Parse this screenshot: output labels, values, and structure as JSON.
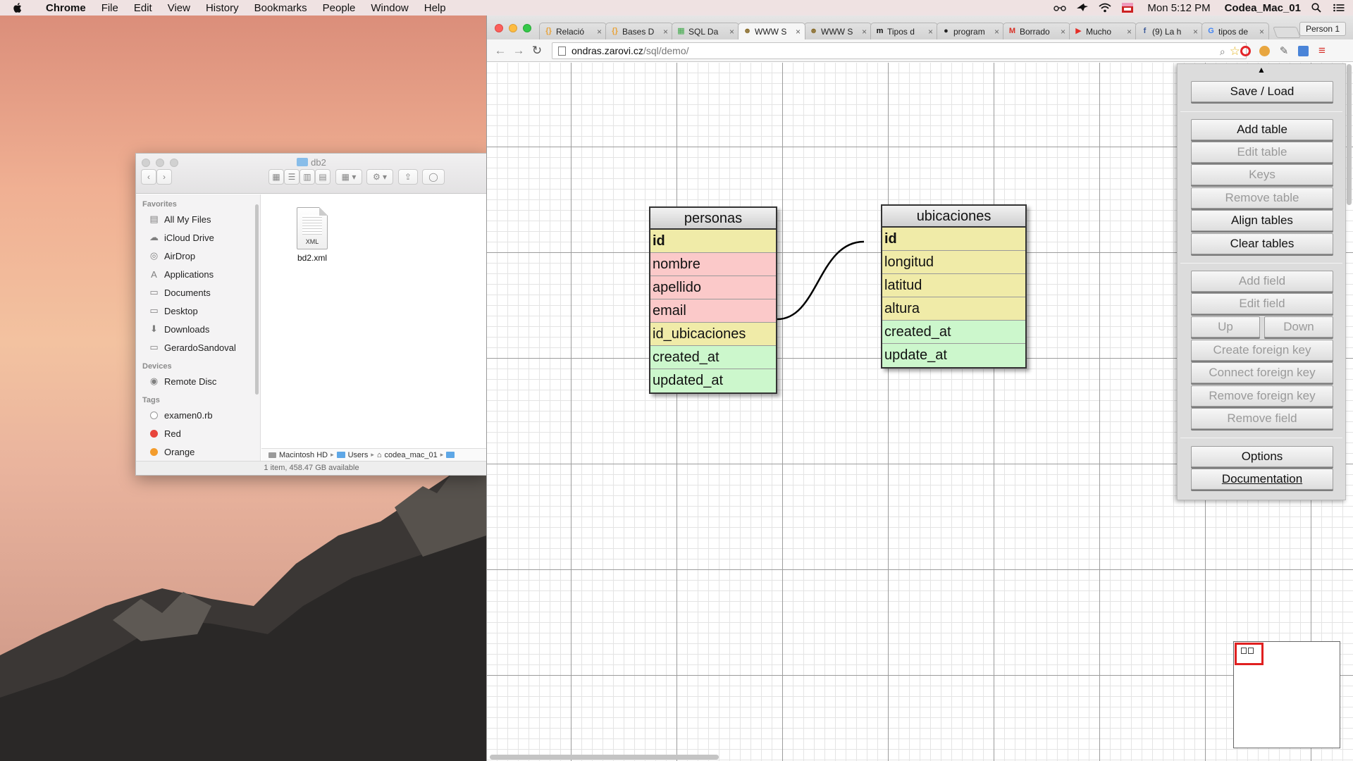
{
  "menubar": {
    "app": "Chrome",
    "items": [
      "File",
      "Edit",
      "View",
      "History",
      "Bookmarks",
      "People",
      "Window",
      "Help"
    ],
    "clock": "Mon 5:12 PM",
    "user": "Codea_Mac_01"
  },
  "finder": {
    "title": "db2",
    "favorites_header": "Favorites",
    "favorites": [
      {
        "label": "All My Files",
        "icon": "all-files-icon"
      },
      {
        "label": "iCloud Drive",
        "icon": "cloud-icon"
      },
      {
        "label": "AirDrop",
        "icon": "airdrop-icon"
      },
      {
        "label": "Applications",
        "icon": "applications-icon"
      },
      {
        "label": "Documents",
        "icon": "documents-icon"
      },
      {
        "label": "Desktop",
        "icon": "desktop-icon"
      },
      {
        "label": "Downloads",
        "icon": "downloads-icon"
      },
      {
        "label": "GerardoSandoval",
        "icon": "folder-icon"
      }
    ],
    "devices_header": "Devices",
    "devices": [
      {
        "label": "Remote Disc",
        "icon": "disc-icon"
      }
    ],
    "tags_header": "Tags",
    "tags": [
      {
        "label": "examen0.rb",
        "color": "#ffffff"
      },
      {
        "label": "Red",
        "color": "#e8453c"
      },
      {
        "label": "Orange",
        "color": "#f39c2c"
      }
    ],
    "file": {
      "name": "bd2.xml",
      "type_label": "XML"
    },
    "path": [
      "Macintosh HD",
      "Users",
      "codea_mac_01"
    ],
    "status": "1 item, 458.47 GB available"
  },
  "chrome": {
    "tabs": [
      {
        "label": "Relació",
        "favicon": "{}",
        "fav_color": "#e8a33b"
      },
      {
        "label": "Bases D",
        "favicon": "{}",
        "fav_color": "#e8a33b"
      },
      {
        "label": "SQL Da",
        "favicon": "▦",
        "fav_color": "#3aa845"
      },
      {
        "label": "WWW S",
        "favicon": "☻",
        "fav_color": "#8a6d2c",
        "active": true
      },
      {
        "label": "WWW S",
        "favicon": "☻",
        "fav_color": "#8a6d2c"
      },
      {
        "label": "Tipos d",
        "favicon": "m",
        "fav_color": "#111111"
      },
      {
        "label": "program",
        "favicon": "●",
        "fav_color": "#222222"
      },
      {
        "label": "Borrado",
        "favicon": "M",
        "fav_color": "#d93025"
      },
      {
        "label": "Mucho",
        "favicon": "▶",
        "fav_color": "#e52d27"
      },
      {
        "label": "(9) La h",
        "favicon": "f",
        "fav_color": "#3b5998"
      },
      {
        "label": "tipos de",
        "favicon": "G",
        "fav_color": "#4285f4"
      }
    ],
    "person": "Person 1",
    "url_host": "ondras.zarovi.cz",
    "url_path": "/sql/demo/"
  },
  "designer": {
    "tables": [
      {
        "name": "personas",
        "fields": [
          {
            "name": "id",
            "color": "#f0eba8",
            "pk": true
          },
          {
            "name": "nombre",
            "color": "#fbc9c9"
          },
          {
            "name": "apellido",
            "color": "#fbc9c9"
          },
          {
            "name": "email",
            "color": "#fbc9c9"
          },
          {
            "name": "id_ubicaciones",
            "color": "#f0eba8"
          },
          {
            "name": "created_at",
            "color": "#ccf7cc"
          },
          {
            "name": "updated_at",
            "color": "#ccf7cc"
          }
        ]
      },
      {
        "name": "ubicaciones",
        "fields": [
          {
            "name": "id",
            "color": "#f0eba8",
            "pk": true
          },
          {
            "name": "longitud",
            "color": "#f0eba8"
          },
          {
            "name": "latitud",
            "color": "#f0eba8"
          },
          {
            "name": "altura",
            "color": "#f0eba8"
          },
          {
            "name": "created_at",
            "color": "#ccf7cc"
          },
          {
            "name": "update_at",
            "color": "#ccf7cc"
          }
        ]
      }
    ],
    "relation": {
      "from": "personas.id_ubicaciones",
      "to": "ubicaciones.id"
    }
  },
  "controls": {
    "toggle": "▲",
    "save_load": "Save / Load",
    "add_table": "Add table",
    "edit_table": "Edit table",
    "keys": "Keys",
    "remove_table": "Remove table",
    "align_tables": "Align tables",
    "clear_tables": "Clear tables",
    "add_field": "Add field",
    "edit_field": "Edit field",
    "up": "Up",
    "down": "Down",
    "create_fk": "Create foreign key",
    "connect_fk": "Connect foreign key",
    "remove_fk": "Remove foreign key",
    "remove_field": "Remove field",
    "options": "Options",
    "documentation": "Documentation"
  }
}
